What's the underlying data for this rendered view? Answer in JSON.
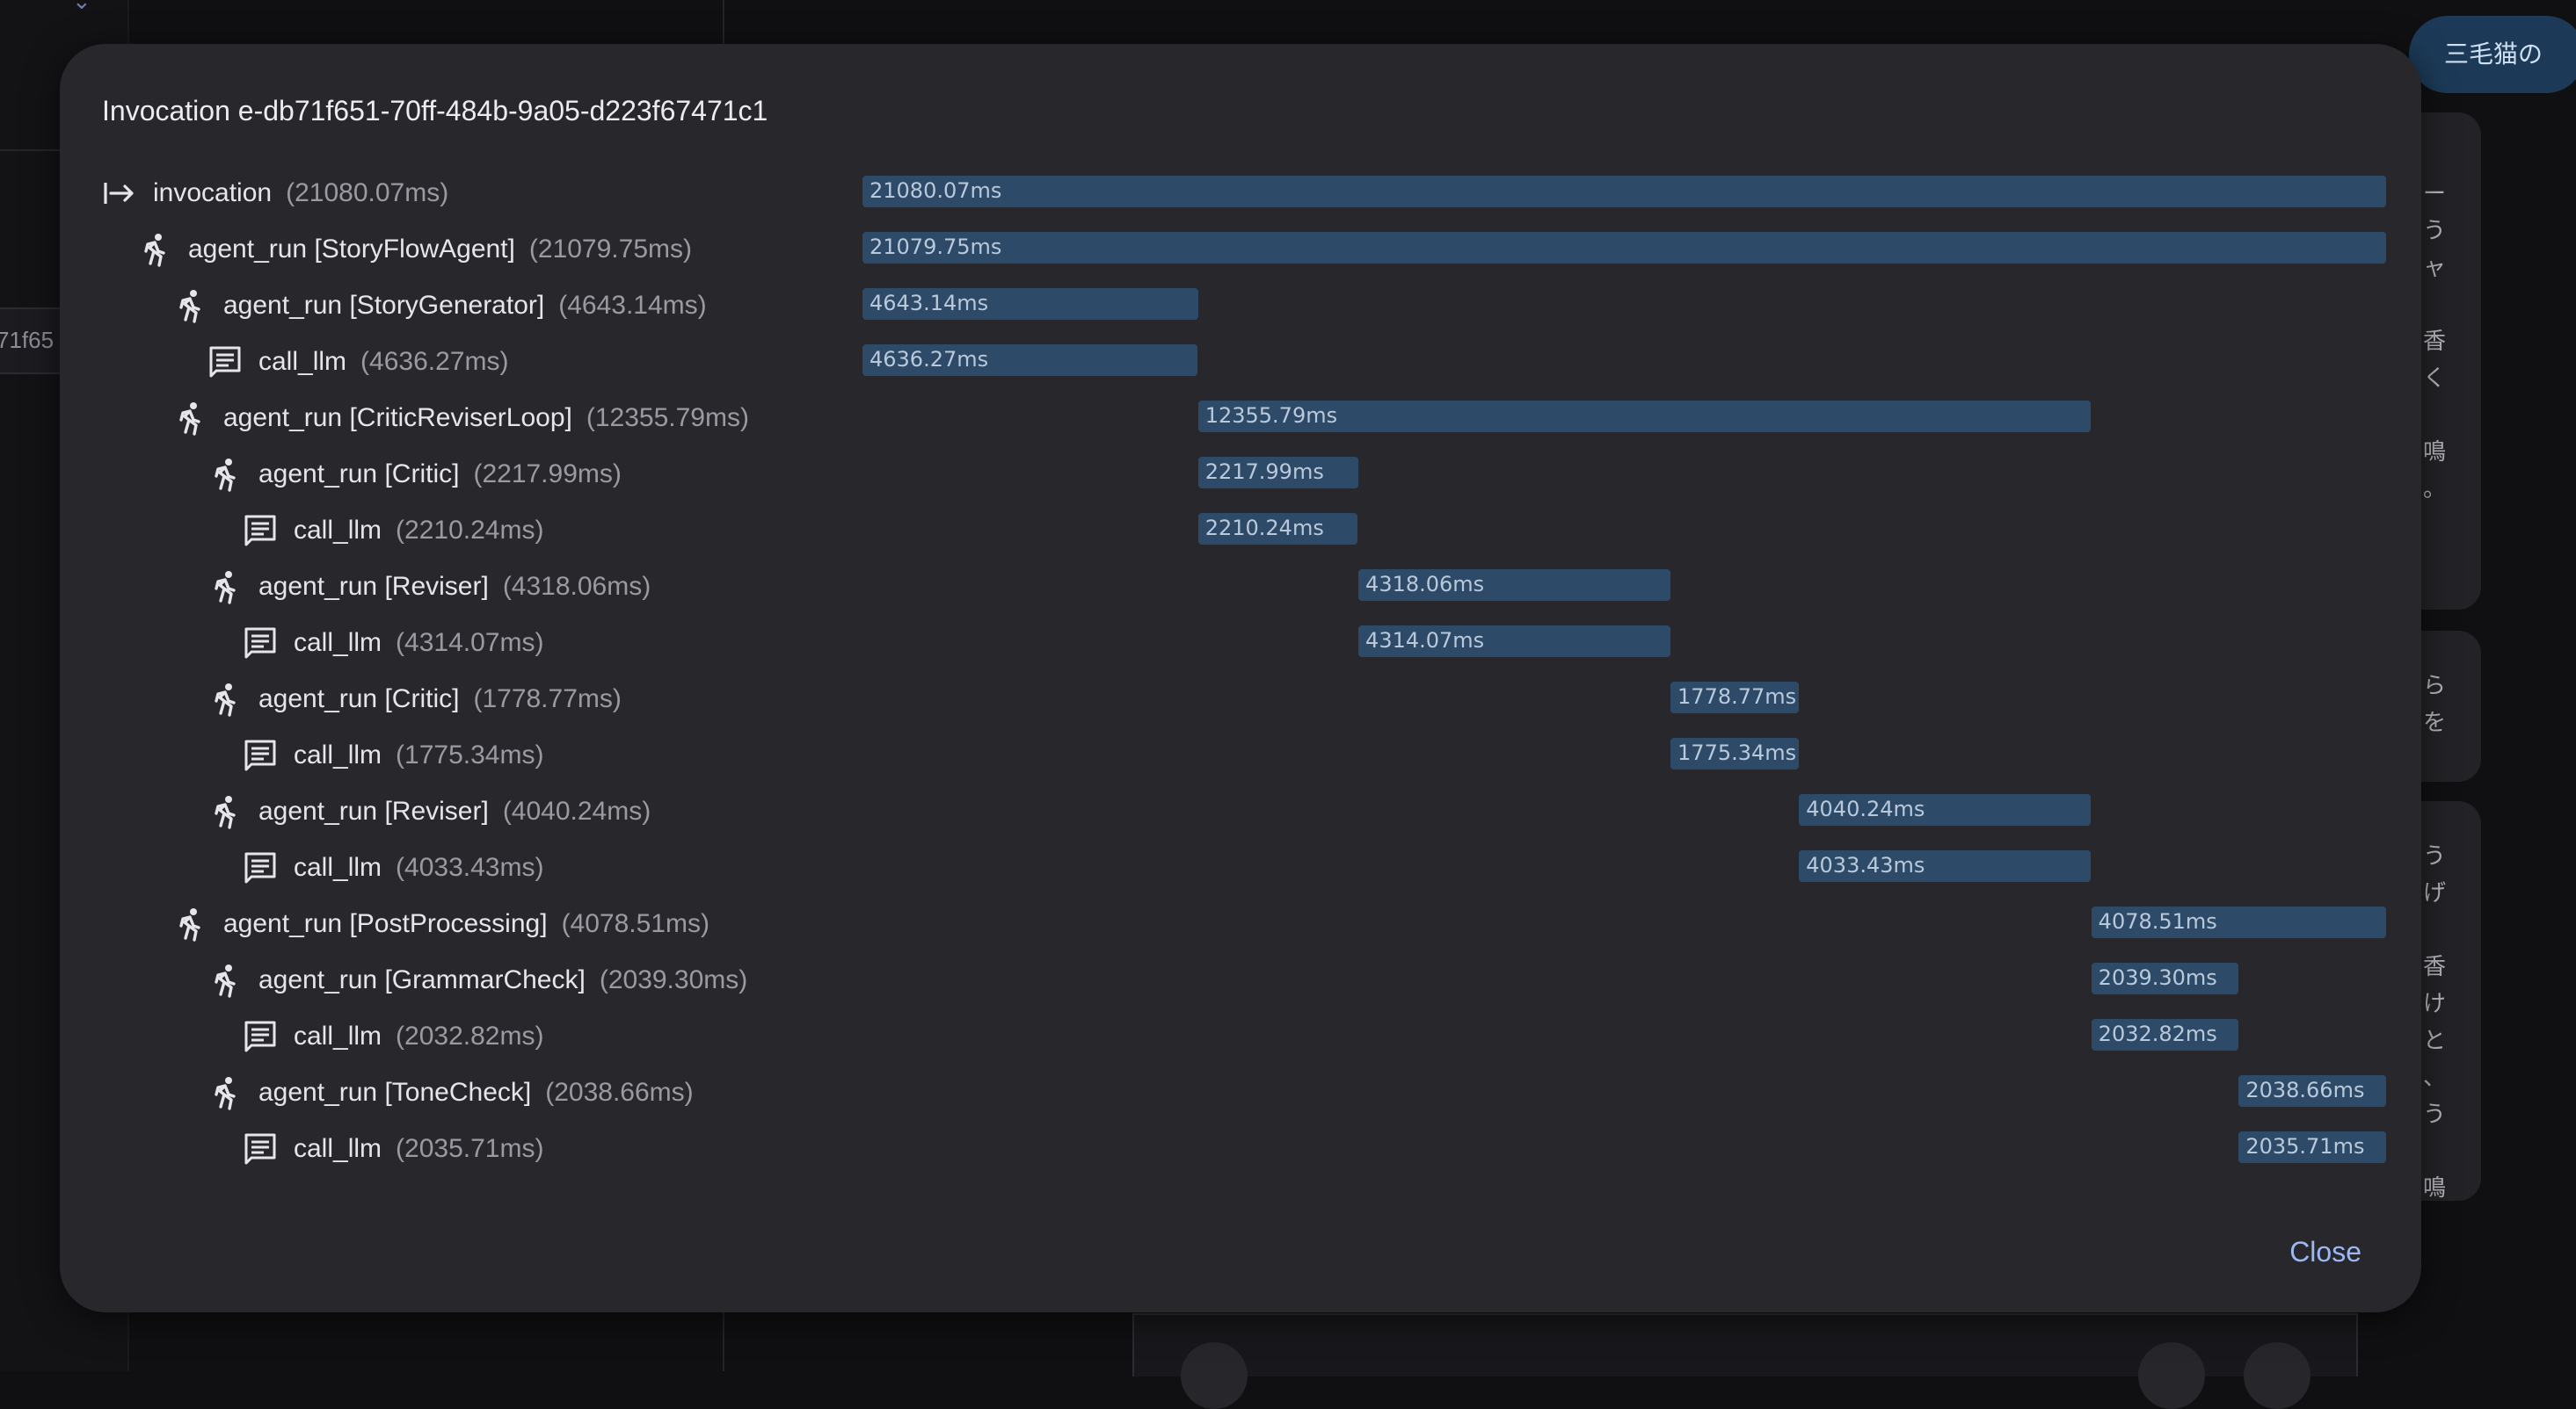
{
  "background": {
    "left_truncated_id": "71f65",
    "pill_text": "三毛猫の",
    "cards": [
      {
        "lines": [
          "ー",
          "う",
          "ャ",
          "",
          "香",
          "く",
          "",
          "鳴",
          "。"
        ]
      },
      {
        "lines": [
          "ら",
          "を"
        ]
      },
      {
        "lines": [
          "う",
          "げ",
          "",
          "香",
          "け",
          "と",
          "、",
          "う",
          "",
          "鳴"
        ]
      }
    ]
  },
  "modal": {
    "title": "Invocation e-db71f651-70ff-484b-9a05-d223f67471c1",
    "close_label": "Close",
    "total_ms": 21080.07,
    "bar_color": "#2d4a68",
    "rows": [
      {
        "icon": "invocation-arrow-icon",
        "name": "invocation",
        "duration": "(21080.07ms)",
        "bar_label": "21080.07ms",
        "start_ms": 0,
        "dur_ms": 21080.07,
        "depth": 0
      },
      {
        "icon": "running-agent-icon",
        "name": "agent_run [StoryFlowAgent]",
        "duration": "(21079.75ms)",
        "bar_label": "21079.75ms",
        "start_ms": 0,
        "dur_ms": 21079.75,
        "depth": 1
      },
      {
        "icon": "running-agent-icon",
        "name": "agent_run [StoryGenerator]",
        "duration": "(4643.14ms)",
        "bar_label": "4643.14ms",
        "start_ms": 0,
        "dur_ms": 4643.14,
        "depth": 2
      },
      {
        "icon": "llm-message-icon",
        "name": "call_llm",
        "duration": "(4636.27ms)",
        "bar_label": "4636.27ms",
        "start_ms": 0,
        "dur_ms": 4636.27,
        "depth": 3
      },
      {
        "icon": "running-agent-icon",
        "name": "agent_run [CriticReviserLoop]",
        "duration": "(12355.79ms)",
        "bar_label": "12355.79ms",
        "start_ms": 4643.14,
        "dur_ms": 12355.79,
        "depth": 2
      },
      {
        "icon": "running-agent-icon",
        "name": "agent_run [Critic]",
        "duration": "(2217.99ms)",
        "bar_label": "2217.99ms",
        "start_ms": 4643.14,
        "dur_ms": 2217.99,
        "depth": 3
      },
      {
        "icon": "llm-message-icon",
        "name": "call_llm",
        "duration": "(2210.24ms)",
        "bar_label": "2210.24ms",
        "start_ms": 4643.14,
        "dur_ms": 2210.24,
        "depth": 4
      },
      {
        "icon": "running-agent-icon",
        "name": "agent_run [Reviser]",
        "duration": "(4318.06ms)",
        "bar_label": "4318.06ms",
        "start_ms": 6861.13,
        "dur_ms": 4318.06,
        "depth": 3
      },
      {
        "icon": "llm-message-icon",
        "name": "call_llm",
        "duration": "(4314.07ms)",
        "bar_label": "4314.07ms",
        "start_ms": 6861.13,
        "dur_ms": 4314.07,
        "depth": 4
      },
      {
        "icon": "running-agent-icon",
        "name": "agent_run [Critic]",
        "duration": "(1778.77ms)",
        "bar_label": "1778.77ms",
        "start_ms": 11179.19,
        "dur_ms": 1778.77,
        "depth": 3
      },
      {
        "icon": "llm-message-icon",
        "name": "call_llm",
        "duration": "(1775.34ms)",
        "bar_label": "1775.34ms",
        "start_ms": 11179.19,
        "dur_ms": 1775.34,
        "depth": 4
      },
      {
        "icon": "running-agent-icon",
        "name": "agent_run [Reviser]",
        "duration": "(4040.24ms)",
        "bar_label": "4040.24ms",
        "start_ms": 12957.96,
        "dur_ms": 4040.24,
        "depth": 3
      },
      {
        "icon": "llm-message-icon",
        "name": "call_llm",
        "duration": "(4033.43ms)",
        "bar_label": "4033.43ms",
        "start_ms": 12957.96,
        "dur_ms": 4033.43,
        "depth": 4
      },
      {
        "icon": "running-agent-icon",
        "name": "agent_run [PostProcessing]",
        "duration": "(4078.51ms)",
        "bar_label": "4078.51ms",
        "start_ms": 17001.24,
        "dur_ms": 4078.51,
        "depth": 2
      },
      {
        "icon": "running-agent-icon",
        "name": "agent_run [GrammarCheck]",
        "duration": "(2039.30ms)",
        "bar_label": "2039.30ms",
        "start_ms": 17001.24,
        "dur_ms": 2039.3,
        "depth": 3
      },
      {
        "icon": "llm-message-icon",
        "name": "call_llm",
        "duration": "(2032.82ms)",
        "bar_label": "2032.82ms",
        "start_ms": 17001.24,
        "dur_ms": 2032.82,
        "depth": 4
      },
      {
        "icon": "running-agent-icon",
        "name": "agent_run [ToneCheck]",
        "duration": "(2038.66ms)",
        "bar_label": "2038.66ms",
        "start_ms": 19040.54,
        "dur_ms": 2038.66,
        "depth": 3
      },
      {
        "icon": "llm-message-icon",
        "name": "call_llm",
        "duration": "(2035.71ms)",
        "bar_label": "2035.71ms",
        "start_ms": 19040.54,
        "dur_ms": 2035.71,
        "depth": 4
      }
    ]
  }
}
